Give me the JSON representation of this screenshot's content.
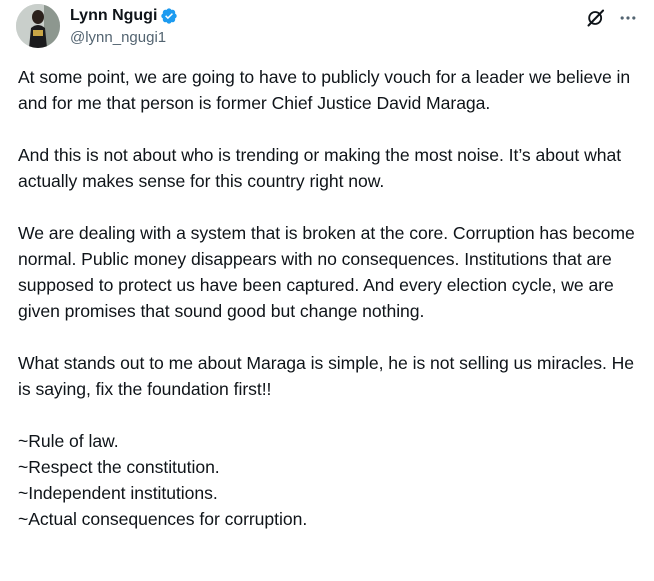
{
  "author": {
    "display_name": "Lynn Ngugi",
    "handle": "@lynn_ngugi1",
    "verified": true,
    "verified_color": "#1d9bf0"
  },
  "icons": {
    "avatar": "profile-photo",
    "verified": "verified-badge-icon",
    "grok": "grok-icon",
    "more": "more-options-icon"
  },
  "tweet": {
    "paragraphs": [
      "At some point, we are going to have to publicly vouch for a leader we believe in and for me that person is former Chief Justice David Maraga.",
      "And this is not about who is trending or making the most noise. It’s about what actually makes sense for this country right now.",
      "We are dealing with a system that is broken at the core. Corruption has become normal. Public money disappears with no consequences. Institutions that are supposed to protect us have been captured. And every election cycle, we are given promises that sound good but change nothing.",
      "What stands out to me about Maraga is simple, he is not selling us miracles. He is saying, fix the foundation first!!"
    ],
    "list": [
      "~Rule of law.",
      "~Respect the constitution.",
      "~Independent institutions.",
      "~Actual consequences for corruption."
    ]
  }
}
